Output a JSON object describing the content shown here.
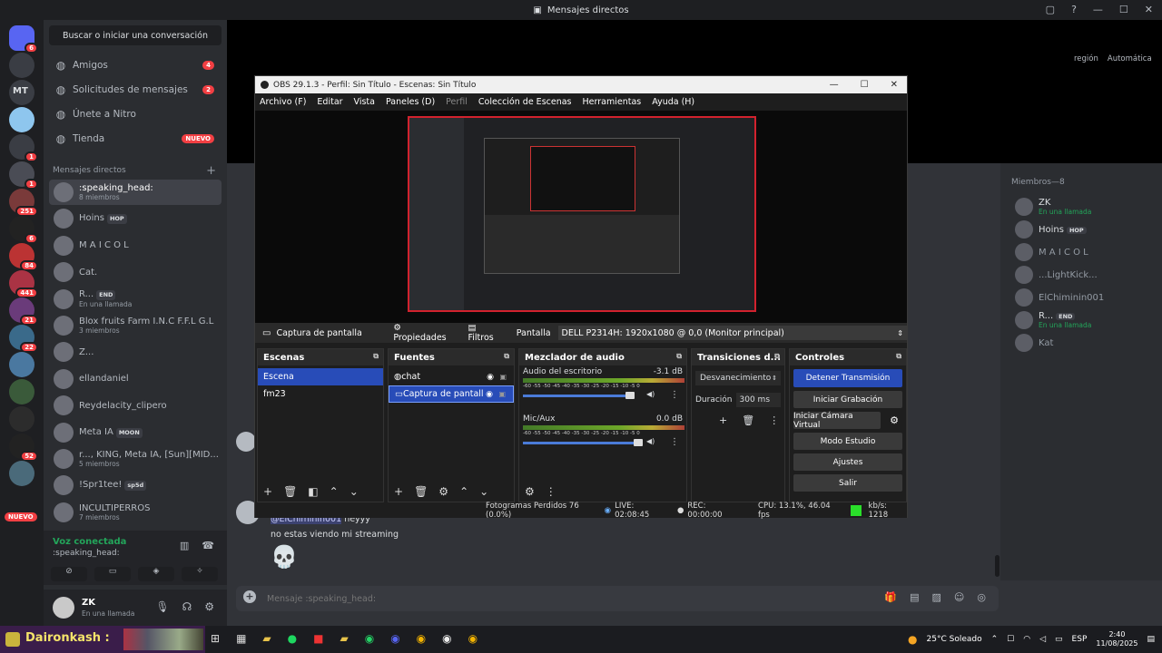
{
  "titlebar": {
    "title": "Mensajes directos"
  },
  "guilds": [
    {
      "badge": "6",
      "color": "#5865f2"
    },
    {
      "badge": "",
      "color": "#3a3d44"
    },
    {
      "badge": "",
      "color": "#3a3d44",
      "text": "MT"
    },
    {
      "badge": "",
      "color": "#8ec6ee"
    },
    {
      "badge": "1",
      "color": "#3a3d44"
    },
    {
      "badge": "1",
      "color": "#4a4c55"
    },
    {
      "badge": "251",
      "color": "#7a3a3a"
    },
    {
      "badge": "6",
      "color": "#222"
    },
    {
      "badge": "84",
      "color": "#b33"
    },
    {
      "badge": "441",
      "color": "#a34"
    },
    {
      "badge": "21",
      "color": "#6a3b7a"
    },
    {
      "badge": "22",
      "color": "#3a6a8a"
    },
    {
      "badge": "",
      "color": "#4a78a0"
    },
    {
      "badge": "",
      "color": "#3a5a3a"
    },
    {
      "badge": "",
      "color": "#2c2c2c"
    },
    {
      "badge": "52",
      "color": "#222"
    },
    {
      "badge": "",
      "color": "#4a6a7a"
    }
  ],
  "guild_new": "NUEVO",
  "dm": {
    "search": "Buscar o iniciar una conversación",
    "nav": [
      {
        "label": "Amigos",
        "badge": "4",
        "icon": "friends-icon"
      },
      {
        "label": "Solicitudes de mensajes",
        "badge": "2",
        "icon": "mail-icon"
      },
      {
        "label": "Únete a Nitro",
        "badge": "",
        "icon": "nitro-icon"
      },
      {
        "label": "Tienda",
        "badge": "NUEVO",
        "icon": "shop-icon"
      }
    ],
    "header": "Mensajes directos",
    "items": [
      {
        "name": ":speaking_head:",
        "sub": "8 miembros",
        "tag": ""
      },
      {
        "name": "Hoins",
        "sub": "",
        "tag": "HOP"
      },
      {
        "name": "M A I C O L",
        "sub": "",
        "tag": ""
      },
      {
        "name": "Cat.",
        "sub": "",
        "tag": ""
      },
      {
        "name": "R...",
        "sub": "En una llamada",
        "tag": "END"
      },
      {
        "name": "Blox fruits Farm I.N.C F.F.L G.L",
        "sub": "3 miembros",
        "tag": ""
      },
      {
        "name": "Z...",
        "sub": "",
        "tag": ""
      },
      {
        "name": "ellandaniel",
        "sub": "",
        "tag": ""
      },
      {
        "name": "Reydelacity_clipero",
        "sub": "",
        "tag": ""
      },
      {
        "name": "Meta IA",
        "sub": "",
        "tag": "MOON"
      },
      {
        "name": "r..., KING, Meta IA, [Sun][MID...",
        "sub": "5 miembros",
        "tag": ""
      },
      {
        "name": "!Spr1tee!",
        "sub": "",
        "tag": "sp5d"
      },
      {
        "name": "INCULTIPERROS",
        "sub": "7 miembros",
        "tag": ""
      }
    ]
  },
  "voice": {
    "title": "Voz conectada",
    "channel": ":speaking_head:"
  },
  "user": {
    "name": "ZK",
    "status": "En una llamada"
  },
  "topright": {
    "region": "región",
    "value": "Automática"
  },
  "members": {
    "header": "Miembros—8",
    "list": [
      {
        "name": "ZK",
        "sub": "En una llamada",
        "tag": ""
      },
      {
        "name": "Hoins",
        "sub": "",
        "tag": "HOP"
      },
      {
        "name": "M A I C O L",
        "sub": "",
        "tag": ""
      },
      {
        "name": "...LightKick...",
        "sub": "",
        "tag": ""
      },
      {
        "name": "ElChiminin001",
        "sub": "",
        "tag": ""
      },
      {
        "name": "R...",
        "sub": "En una llamada",
        "tag": "END"
      },
      {
        "name": "Kat",
        "sub": "",
        "tag": ""
      }
    ]
  },
  "chat": {
    "mention": "@ElChiminin001",
    "msg1": "heyyy",
    "msg2": "no estas viendo mi streaming",
    "skull": "💀",
    "placeholder": "Mensaje :speaking_head:"
  },
  "obs": {
    "title": "OBS 29.1.3 - Perfil: Sin Título - Escenas: Sin Título",
    "menu": [
      "Archivo (F)",
      "Editar",
      "Vista",
      "Paneles (D)",
      "Perfil",
      "Colección de Escenas",
      "Herramientas",
      "Ayuda (H)"
    ],
    "source_name": "Captura de pantalla",
    "props": "Propiedades",
    "filters": "Filtros",
    "display_label": "Pantalla",
    "display_value": "DELL P2314H: 1920x1080 @ 0,0 (Monitor principal)",
    "scenes_title": "Escenas",
    "scenes": [
      "Escena",
      "fm23"
    ],
    "sources_title": "Fuentes",
    "sources": [
      "chat",
      "Captura de pantall"
    ],
    "mixer_title": "Mezclador de audio",
    "mixer": [
      {
        "name": "Audio del escritorio",
        "db": "-3.1 dB",
        "level": 0.9
      },
      {
        "name": "Mic/Aux",
        "db": "0.0 dB",
        "level": 0.97
      }
    ],
    "scale": "-60 -55 -50 -45 -40 -35 -30 -25 -20 -15 -10 -5 0",
    "transitions_title": "Transiciones d...",
    "transition": "Desvanecimiento",
    "duration_label": "Duración",
    "duration": "300 ms",
    "controls_title": "Controles",
    "controls": [
      "Detener Transmisión",
      "Iniciar Grabación",
      "Iniciar Cámara Virtual",
      "Modo Estudio",
      "Ajustes",
      "Salir"
    ],
    "status": {
      "dropped": "Fotogramas Perdidos 76 (0.0%)",
      "live": "LIVE: 02:08:45",
      "rec": "REC: 00:00:00",
      "cpu": "CPU: 13.1%, 46.04 fps",
      "kbs": "kb/s: 1218"
    }
  },
  "taskbar": {
    "user": "Daironkash :",
    "weather": "25°C  Soleado",
    "lang": "ESP",
    "time": "2:40",
    "date": "11/08/2025"
  }
}
